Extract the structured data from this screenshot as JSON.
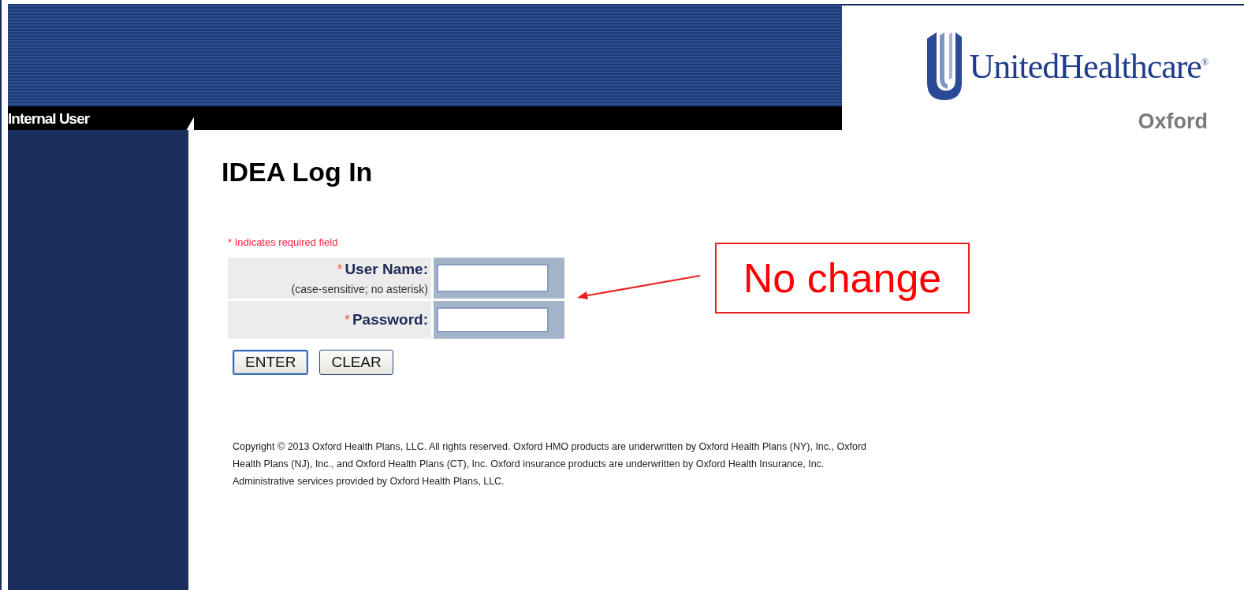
{
  "header": {
    "section_label": "Internal User",
    "brand": "UnitedHealthcare",
    "brand_mark": "®",
    "sub_brand": "Oxford"
  },
  "page_title": "IDEA Log In",
  "required_note": "* Indicates required field",
  "form": {
    "fields": [
      {
        "required_mark": "*",
        "label": "User Name:",
        "hint": "(case-sensitive; no asterisk)"
      },
      {
        "required_mark": "*",
        "label": "Password:"
      }
    ],
    "buttons": [
      {
        "label": "ENTER",
        "selected": true
      },
      {
        "label": "CLEAR",
        "selected": false
      }
    ]
  },
  "copyright": "Copyright © 2013 Oxford Health Plans, LLC. All rights reserved. Oxford HMO products are underwritten by Oxford Health Plans (NY), Inc., Oxford Health Plans (NJ), Inc., and Oxford Health Plans (CT), Inc. Oxford insurance products are underwritten by Oxford Health Insurance, Inc. Administrative services provided by Oxford Health Plans, LLC.",
  "annotation": {
    "text": "No change"
  }
}
